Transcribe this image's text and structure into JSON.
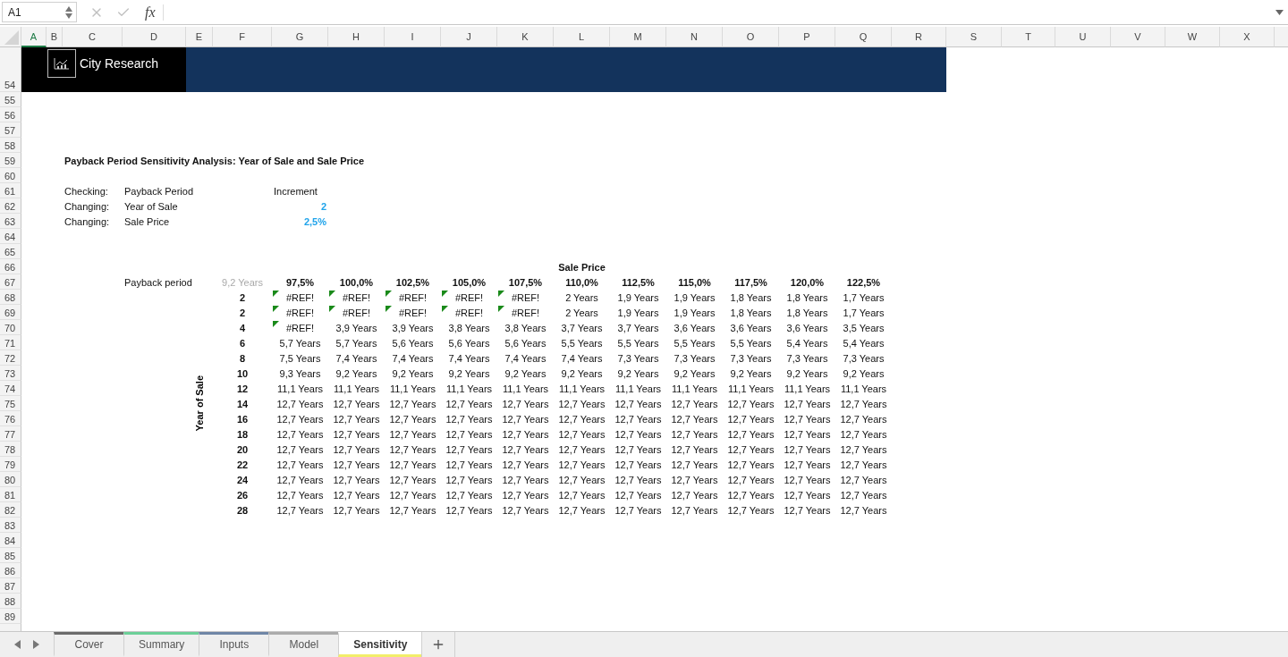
{
  "formula_bar": {
    "name_box": "A1",
    "function_label": "fx"
  },
  "columns": [
    {
      "label": "A",
      "selected": true
    },
    {
      "label": "B",
      "selected": false
    },
    {
      "label": "C",
      "selected": false
    },
    {
      "label": "D",
      "selected": false
    },
    {
      "label": "E",
      "selected": false
    },
    {
      "label": "F",
      "selected": false
    },
    {
      "label": "G",
      "selected": false
    },
    {
      "label": "H",
      "selected": false
    },
    {
      "label": "I",
      "selected": false
    },
    {
      "label": "J",
      "selected": false
    },
    {
      "label": "K",
      "selected": false
    },
    {
      "label": "L",
      "selected": false
    },
    {
      "label": "M",
      "selected": false
    },
    {
      "label": "N",
      "selected": false
    },
    {
      "label": "O",
      "selected": false
    },
    {
      "label": "P",
      "selected": false
    },
    {
      "label": "Q",
      "selected": false
    },
    {
      "label": "R",
      "selected": false
    },
    {
      "label": "S",
      "selected": false
    },
    {
      "label": "T",
      "selected": false
    },
    {
      "label": "U",
      "selected": false
    },
    {
      "label": "V",
      "selected": false
    },
    {
      "label": "W",
      "selected": false
    },
    {
      "label": "X",
      "selected": false
    }
  ],
  "row_numbers": [
    "54",
    "55",
    "56",
    "57",
    "58",
    "59",
    "60",
    "61",
    "62",
    "63",
    "64",
    "65",
    "66",
    "67",
    "68",
    "69",
    "70",
    "71",
    "72",
    "73",
    "74",
    "75",
    "76",
    "77",
    "78",
    "79",
    "80",
    "81",
    "82",
    "83",
    "84",
    "85",
    "86",
    "87",
    "88",
    "89"
  ],
  "banner": {
    "title": "City Research"
  },
  "title": "Payback Period Sensitivity Analysis: Year of Sale and Sale Price",
  "settings_header": "Increment",
  "settings": [
    {
      "label": "Checking:",
      "value": "Payback Period"
    },
    {
      "label": "Changing:",
      "value": "Year of Sale",
      "increment": "2"
    },
    {
      "label": "Changing:",
      "value": "Sale Price",
      "increment": "2,5%"
    }
  ],
  "table": {
    "column_axis_label": "Sale Price",
    "row_axis_label": "Year of Sale",
    "corner_label": "Payback period",
    "base_value": "9,2 Years",
    "columns": [
      "97,5%",
      "100,0%",
      "102,5%",
      "105,0%",
      "107,5%",
      "110,0%",
      "112,5%",
      "115,0%",
      "117,5%",
      "120,0%",
      "122,5%"
    ],
    "rows": [
      {
        "year": "2",
        "cells": [
          {
            "text": "#REF!",
            "error_flag": true
          },
          {
            "text": "#REF!",
            "error_flag": true
          },
          {
            "text": "#REF!",
            "error_flag": true
          },
          {
            "text": "#REF!",
            "error_flag": true
          },
          {
            "text": "#REF!",
            "error_flag": true
          },
          {
            "text": "2 Years",
            "error_flag": false
          },
          {
            "text": "1,9 Years",
            "error_flag": false
          },
          {
            "text": "1,9 Years",
            "error_flag": false
          },
          {
            "text": "1,8 Years",
            "error_flag": false
          },
          {
            "text": "1,8 Years",
            "error_flag": false
          },
          {
            "text": "1,7 Years",
            "error_flag": false
          }
        ]
      },
      {
        "year": "2",
        "cells": [
          {
            "text": "#REF!",
            "error_flag": true
          },
          {
            "text": "#REF!",
            "error_flag": true
          },
          {
            "text": "#REF!",
            "error_flag": true
          },
          {
            "text": "#REF!",
            "error_flag": true
          },
          {
            "text": "#REF!",
            "error_flag": true
          },
          {
            "text": "2 Years",
            "error_flag": false
          },
          {
            "text": "1,9 Years",
            "error_flag": false
          },
          {
            "text": "1,9 Years",
            "error_flag": false
          },
          {
            "text": "1,8 Years",
            "error_flag": false
          },
          {
            "text": "1,8 Years",
            "error_flag": false
          },
          {
            "text": "1,7 Years",
            "error_flag": false
          }
        ]
      },
      {
        "year": "4",
        "cells": [
          {
            "text": "#REF!",
            "error_flag": true
          },
          {
            "text": "3,9 Years",
            "error_flag": false
          },
          {
            "text": "3,9 Years",
            "error_flag": false
          },
          {
            "text": "3,8 Years",
            "error_flag": false
          },
          {
            "text": "3,8 Years",
            "error_flag": false
          },
          {
            "text": "3,7 Years",
            "error_flag": false
          },
          {
            "text": "3,7 Years",
            "error_flag": false
          },
          {
            "text": "3,6 Years",
            "error_flag": false
          },
          {
            "text": "3,6 Years",
            "error_flag": false
          },
          {
            "text": "3,6 Years",
            "error_flag": false
          },
          {
            "text": "3,5 Years",
            "error_flag": false
          }
        ]
      },
      {
        "year": "6",
        "cells": [
          {
            "text": "5,7 Years",
            "error_flag": false
          },
          {
            "text": "5,7 Years",
            "error_flag": false
          },
          {
            "text": "5,6 Years",
            "error_flag": false
          },
          {
            "text": "5,6 Years",
            "error_flag": false
          },
          {
            "text": "5,6 Years",
            "error_flag": false
          },
          {
            "text": "5,5 Years",
            "error_flag": false
          },
          {
            "text": "5,5 Years",
            "error_flag": false
          },
          {
            "text": "5,5 Years",
            "error_flag": false
          },
          {
            "text": "5,5 Years",
            "error_flag": false
          },
          {
            "text": "5,4 Years",
            "error_flag": false
          },
          {
            "text": "5,4 Years",
            "error_flag": false
          }
        ]
      },
      {
        "year": "8",
        "cells": [
          {
            "text": "7,5 Years",
            "error_flag": false
          },
          {
            "text": "7,4 Years",
            "error_flag": false
          },
          {
            "text": "7,4 Years",
            "error_flag": false
          },
          {
            "text": "7,4 Years",
            "error_flag": false
          },
          {
            "text": "7,4 Years",
            "error_flag": false
          },
          {
            "text": "7,4 Years",
            "error_flag": false
          },
          {
            "text": "7,3 Years",
            "error_flag": false
          },
          {
            "text": "7,3 Years",
            "error_flag": false
          },
          {
            "text": "7,3 Years",
            "error_flag": false
          },
          {
            "text": "7,3 Years",
            "error_flag": false
          },
          {
            "text": "7,3 Years",
            "error_flag": false
          }
        ]
      },
      {
        "year": "10",
        "cells": [
          {
            "text": "9,3 Years",
            "error_flag": false
          },
          {
            "text": "9,2 Years",
            "error_flag": false
          },
          {
            "text": "9,2 Years",
            "error_flag": false
          },
          {
            "text": "9,2 Years",
            "error_flag": false
          },
          {
            "text": "9,2 Years",
            "error_flag": false
          },
          {
            "text": "9,2 Years",
            "error_flag": false
          },
          {
            "text": "9,2 Years",
            "error_flag": false
          },
          {
            "text": "9,2 Years",
            "error_flag": false
          },
          {
            "text": "9,2 Years",
            "error_flag": false
          },
          {
            "text": "9,2 Years",
            "error_flag": false
          },
          {
            "text": "9,2 Years",
            "error_flag": false
          }
        ]
      },
      {
        "year": "12",
        "cells": [
          {
            "text": "11,1 Years",
            "error_flag": false
          },
          {
            "text": "11,1 Years",
            "error_flag": false
          },
          {
            "text": "11,1 Years",
            "error_flag": false
          },
          {
            "text": "11,1 Years",
            "error_flag": false
          },
          {
            "text": "11,1 Years",
            "error_flag": false
          },
          {
            "text": "11,1 Years",
            "error_flag": false
          },
          {
            "text": "11,1 Years",
            "error_flag": false
          },
          {
            "text": "11,1 Years",
            "error_flag": false
          },
          {
            "text": "11,1 Years",
            "error_flag": false
          },
          {
            "text": "11,1 Years",
            "error_flag": false
          },
          {
            "text": "11,1 Years",
            "error_flag": false
          }
        ]
      },
      {
        "year": "14",
        "cells": [
          {
            "text": "12,7 Years",
            "error_flag": false
          },
          {
            "text": "12,7 Years",
            "error_flag": false
          },
          {
            "text": "12,7 Years",
            "error_flag": false
          },
          {
            "text": "12,7 Years",
            "error_flag": false
          },
          {
            "text": "12,7 Years",
            "error_flag": false
          },
          {
            "text": "12,7 Years",
            "error_flag": false
          },
          {
            "text": "12,7 Years",
            "error_flag": false
          },
          {
            "text": "12,7 Years",
            "error_flag": false
          },
          {
            "text": "12,7 Years",
            "error_flag": false
          },
          {
            "text": "12,7 Years",
            "error_flag": false
          },
          {
            "text": "12,7 Years",
            "error_flag": false
          }
        ]
      },
      {
        "year": "16",
        "cells": [
          {
            "text": "12,7 Years",
            "error_flag": false
          },
          {
            "text": "12,7 Years",
            "error_flag": false
          },
          {
            "text": "12,7 Years",
            "error_flag": false
          },
          {
            "text": "12,7 Years",
            "error_flag": false
          },
          {
            "text": "12,7 Years",
            "error_flag": false
          },
          {
            "text": "12,7 Years",
            "error_flag": false
          },
          {
            "text": "12,7 Years",
            "error_flag": false
          },
          {
            "text": "12,7 Years",
            "error_flag": false
          },
          {
            "text": "12,7 Years",
            "error_flag": false
          },
          {
            "text": "12,7 Years",
            "error_flag": false
          },
          {
            "text": "12,7 Years",
            "error_flag": false
          }
        ]
      },
      {
        "year": "18",
        "cells": [
          {
            "text": "12,7 Years",
            "error_flag": false
          },
          {
            "text": "12,7 Years",
            "error_flag": false
          },
          {
            "text": "12,7 Years",
            "error_flag": false
          },
          {
            "text": "12,7 Years",
            "error_flag": false
          },
          {
            "text": "12,7 Years",
            "error_flag": false
          },
          {
            "text": "12,7 Years",
            "error_flag": false
          },
          {
            "text": "12,7 Years",
            "error_flag": false
          },
          {
            "text": "12,7 Years",
            "error_flag": false
          },
          {
            "text": "12,7 Years",
            "error_flag": false
          },
          {
            "text": "12,7 Years",
            "error_flag": false
          },
          {
            "text": "12,7 Years",
            "error_flag": false
          }
        ]
      },
      {
        "year": "20",
        "cells": [
          {
            "text": "12,7 Years",
            "error_flag": false
          },
          {
            "text": "12,7 Years",
            "error_flag": false
          },
          {
            "text": "12,7 Years",
            "error_flag": false
          },
          {
            "text": "12,7 Years",
            "error_flag": false
          },
          {
            "text": "12,7 Years",
            "error_flag": false
          },
          {
            "text": "12,7 Years",
            "error_flag": false
          },
          {
            "text": "12,7 Years",
            "error_flag": false
          },
          {
            "text": "12,7 Years",
            "error_flag": false
          },
          {
            "text": "12,7 Years",
            "error_flag": false
          },
          {
            "text": "12,7 Years",
            "error_flag": false
          },
          {
            "text": "12,7 Years",
            "error_flag": false
          }
        ]
      },
      {
        "year": "22",
        "cells": [
          {
            "text": "12,7 Years",
            "error_flag": false
          },
          {
            "text": "12,7 Years",
            "error_flag": false
          },
          {
            "text": "12,7 Years",
            "error_flag": false
          },
          {
            "text": "12,7 Years",
            "error_flag": false
          },
          {
            "text": "12,7 Years",
            "error_flag": false
          },
          {
            "text": "12,7 Years",
            "error_flag": false
          },
          {
            "text": "12,7 Years",
            "error_flag": false
          },
          {
            "text": "12,7 Years",
            "error_flag": false
          },
          {
            "text": "12,7 Years",
            "error_flag": false
          },
          {
            "text": "12,7 Years",
            "error_flag": false
          },
          {
            "text": "12,7 Years",
            "error_flag": false
          }
        ]
      },
      {
        "year": "24",
        "cells": [
          {
            "text": "12,7 Years",
            "error_flag": false
          },
          {
            "text": "12,7 Years",
            "error_flag": false
          },
          {
            "text": "12,7 Years",
            "error_flag": false
          },
          {
            "text": "12,7 Years",
            "error_flag": false
          },
          {
            "text": "12,7 Years",
            "error_flag": false
          },
          {
            "text": "12,7 Years",
            "error_flag": false
          },
          {
            "text": "12,7 Years",
            "error_flag": false
          },
          {
            "text": "12,7 Years",
            "error_flag": false
          },
          {
            "text": "12,7 Years",
            "error_flag": false
          },
          {
            "text": "12,7 Years",
            "error_flag": false
          },
          {
            "text": "12,7 Years",
            "error_flag": false
          }
        ]
      },
      {
        "year": "26",
        "cells": [
          {
            "text": "12,7 Years",
            "error_flag": false
          },
          {
            "text": "12,7 Years",
            "error_flag": false
          },
          {
            "text": "12,7 Years",
            "error_flag": false
          },
          {
            "text": "12,7 Years",
            "error_flag": false
          },
          {
            "text": "12,7 Years",
            "error_flag": false
          },
          {
            "text": "12,7 Years",
            "error_flag": false
          },
          {
            "text": "12,7 Years",
            "error_flag": false
          },
          {
            "text": "12,7 Years",
            "error_flag": false
          },
          {
            "text": "12,7 Years",
            "error_flag": false
          },
          {
            "text": "12,7 Years",
            "error_flag": false
          },
          {
            "text": "12,7 Years",
            "error_flag": false
          }
        ]
      },
      {
        "year": "28",
        "cells": [
          {
            "text": "12,7 Years",
            "error_flag": false
          },
          {
            "text": "12,7 Years",
            "error_flag": false
          },
          {
            "text": "12,7 Years",
            "error_flag": false
          },
          {
            "text": "12,7 Years",
            "error_flag": false
          },
          {
            "text": "12,7 Years",
            "error_flag": false
          },
          {
            "text": "12,7 Years",
            "error_flag": false
          },
          {
            "text": "12,7 Years",
            "error_flag": false
          },
          {
            "text": "12,7 Years",
            "error_flag": false
          },
          {
            "text": "12,7 Years",
            "error_flag": false
          },
          {
            "text": "12,7 Years",
            "error_flag": false
          },
          {
            "text": "12,7 Years",
            "error_flag": false
          }
        ]
      }
    ]
  },
  "sheet_tabs": [
    {
      "label": "Cover",
      "selected": false,
      "color": "#6b6b6b"
    },
    {
      "label": "Summary",
      "selected": false,
      "color": "#6ccf98"
    },
    {
      "label": "Inputs",
      "selected": false,
      "color": "#6f86a6"
    },
    {
      "label": "Model",
      "selected": false,
      "color": "#ababab"
    },
    {
      "label": "Sensitivity",
      "selected": true,
      "color": "#f2ee6a"
    }
  ]
}
